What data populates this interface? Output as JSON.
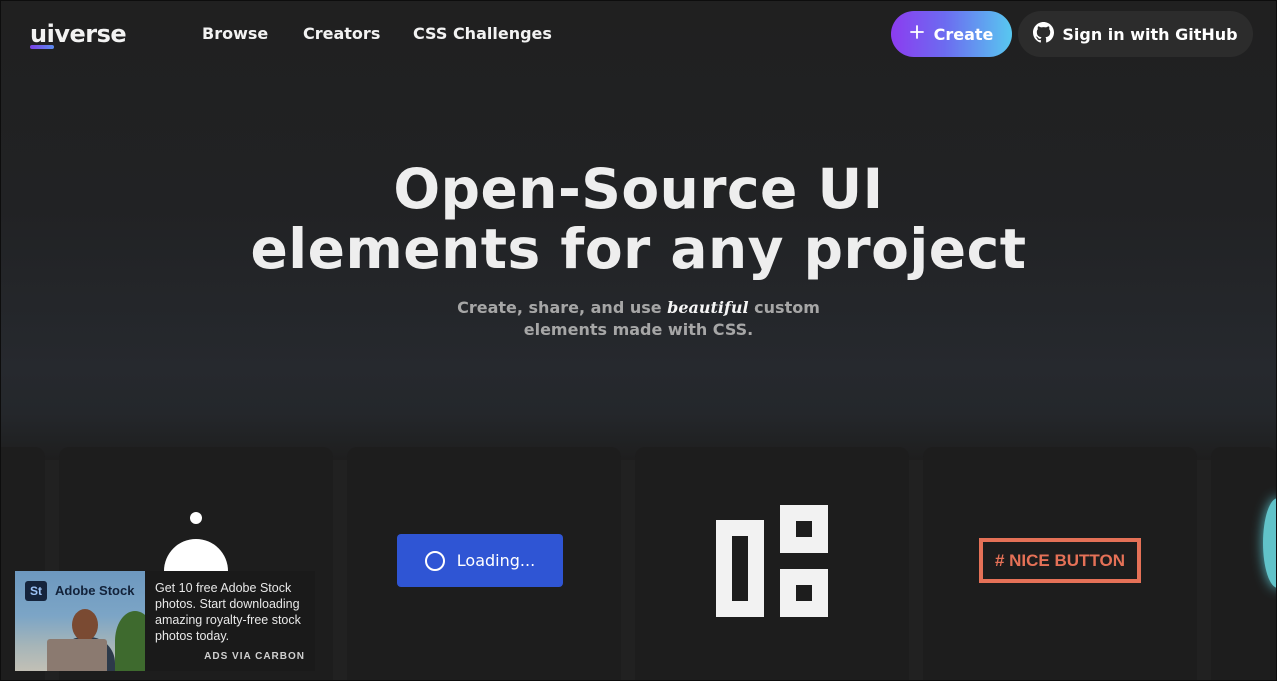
{
  "header": {
    "logo_ui": "ui",
    "logo_rest": "verse",
    "nav": [
      "Browse",
      "Creators",
      "CSS Challenges"
    ],
    "create_label": "Create",
    "github_label": "Sign in with GitHub"
  },
  "hero": {
    "title_line1": "Open-Source UI",
    "title_line2": "elements for any project",
    "subtitle_pre": "Create, share, and use ",
    "subtitle_em": "beautiful",
    "subtitle_post": " custom",
    "subtitle_line2": "elements made with CSS."
  },
  "cards": {
    "loading_label": "Loading...",
    "nice_button_label": "# NICE BUTTON"
  },
  "ad": {
    "brand": "Adobe Stock",
    "logo_text": "St",
    "text": "Get 10 free Adobe Stock photos. Start downloading amazing royalty-free stock photos today.",
    "via": "ADS VIA CARBON"
  },
  "colors": {
    "background": "#212121",
    "card": "#1d1d1d",
    "create_gradient_start": "#8c3cf0",
    "create_gradient_end": "#58c8f0",
    "loading_button": "#2f55d4",
    "nice_button": "#e57157"
  },
  "icons": [
    "plus-icon",
    "github-icon",
    "spinner-icon"
  ]
}
